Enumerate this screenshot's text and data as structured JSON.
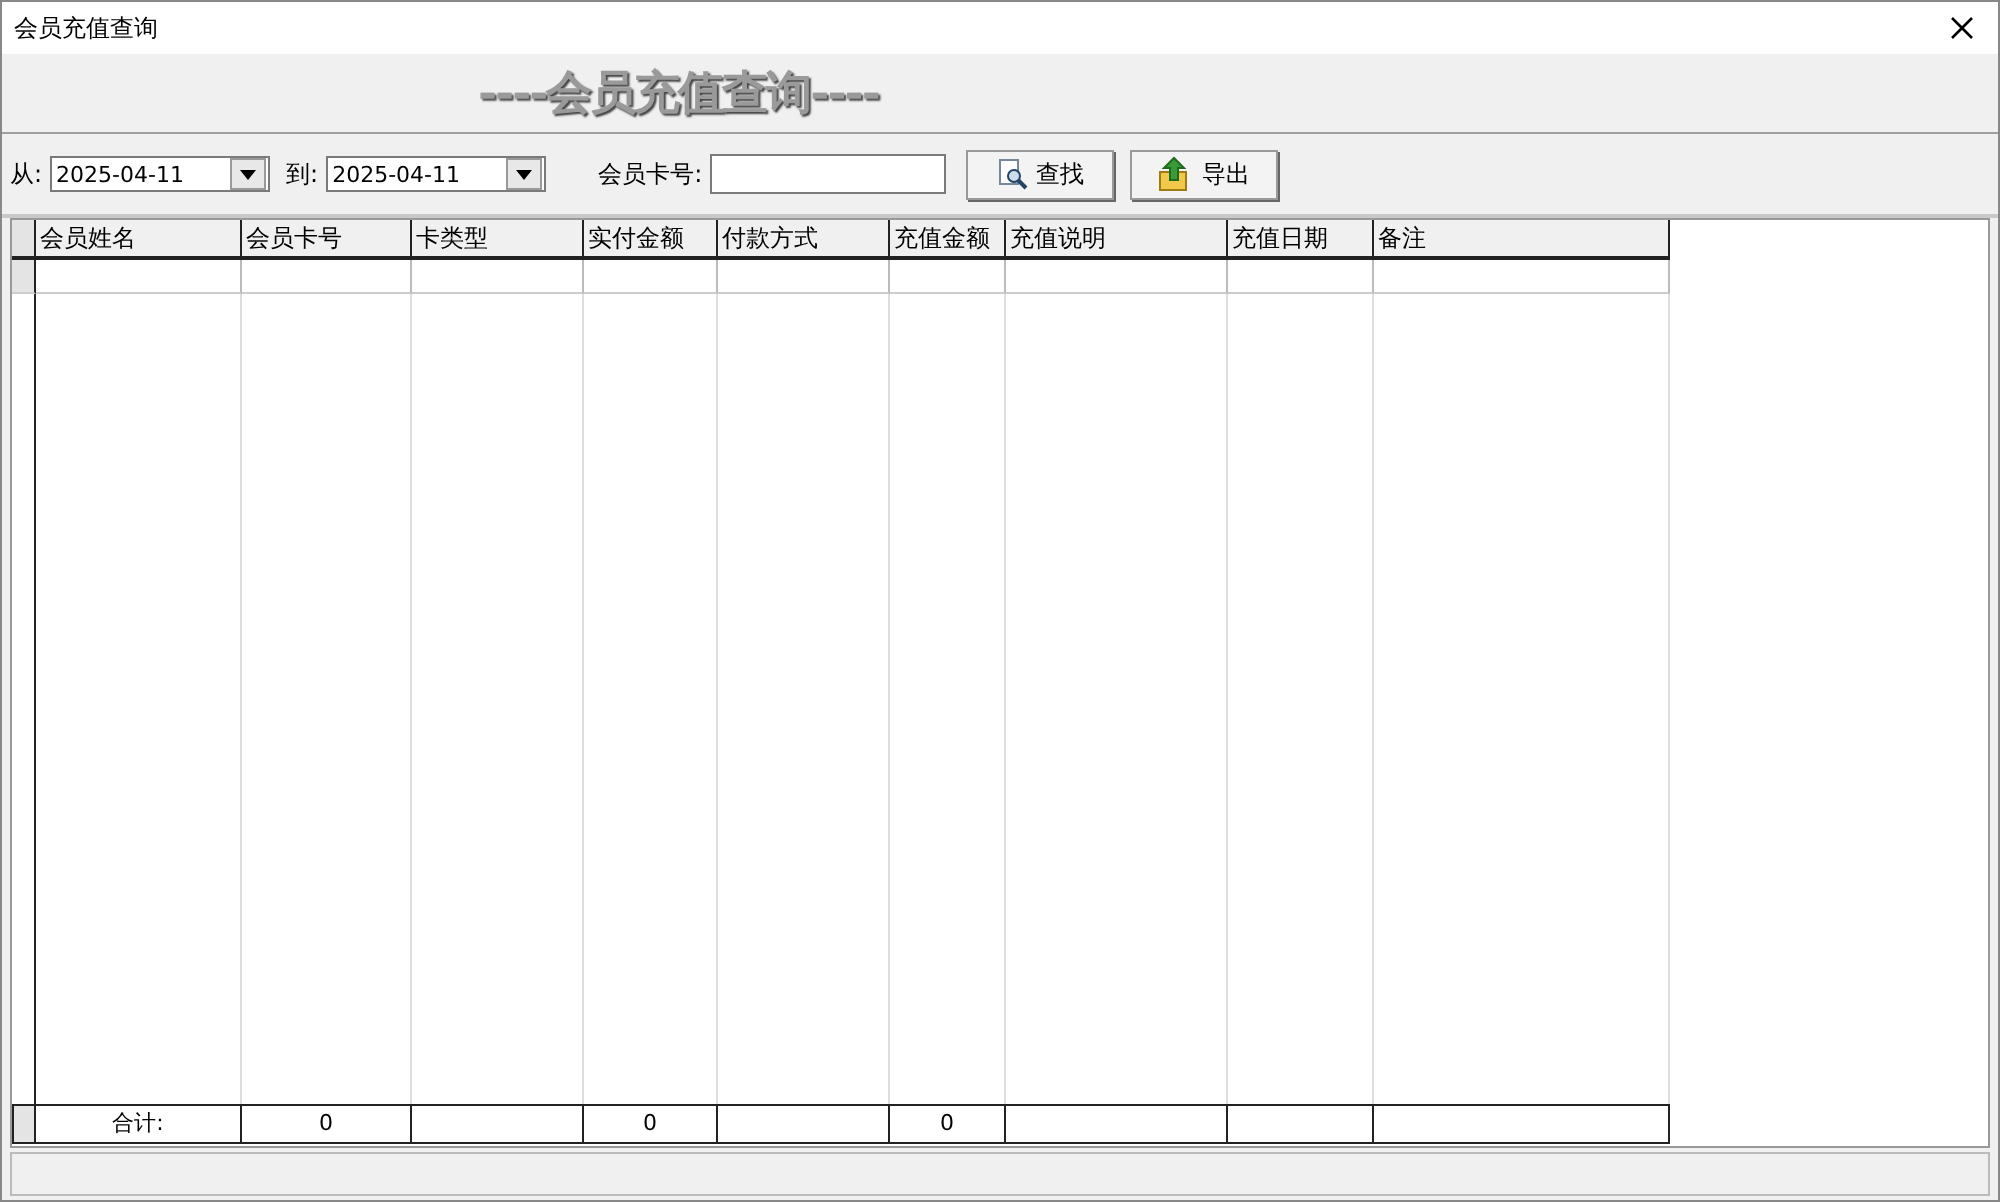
{
  "window": {
    "title": "会员充值查询"
  },
  "banner": "----会员充值查询----",
  "filters": {
    "from_label": "从:",
    "from_value": "2025-04-11",
    "to_label": "到:",
    "to_value": "2025-04-11",
    "card_label": "会员卡号:"
  },
  "buttons": [
    {
      "kind": "search",
      "label": "查找"
    },
    {
      "kind": "export",
      "label": "导出"
    }
  ],
  "table": {
    "columns": [
      {
        "label": "会员姓名",
        "total": "合计:"
      },
      {
        "label": "会员卡号",
        "total": "0"
      },
      {
        "label": "卡类型"
      },
      {
        "label": "实付金额",
        "total": "0"
      },
      {
        "label": "付款方式"
      },
      {
        "label": "充值金额",
        "total": "0"
      },
      {
        "label": "充值说明"
      },
      {
        "label": "充值日期"
      },
      {
        "label": "备注"
      }
    ]
  }
}
